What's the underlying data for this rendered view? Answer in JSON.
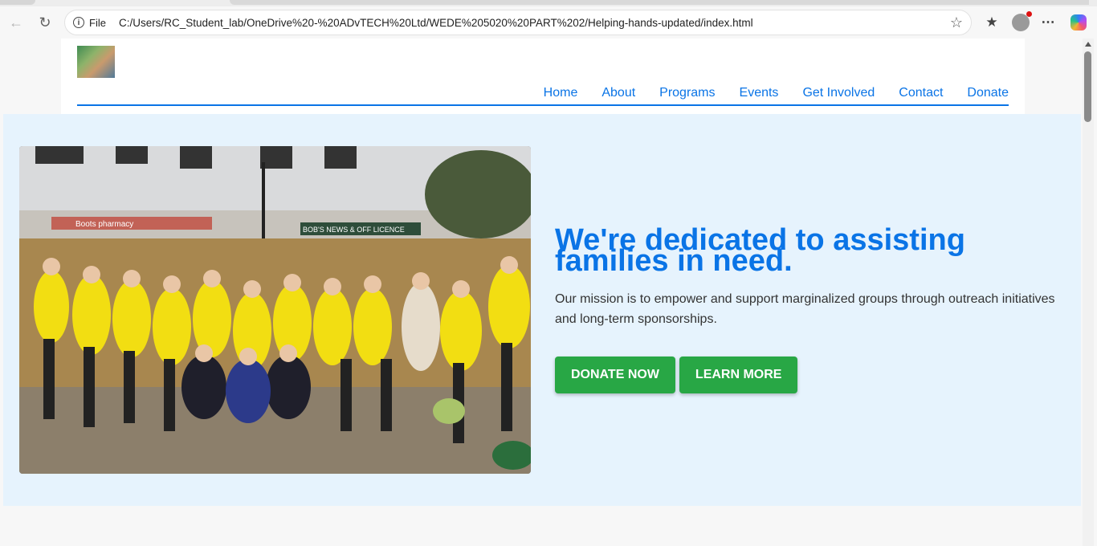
{
  "browser": {
    "scheme_label": "File",
    "url": "C:/Users/RC_Student_lab/OneDrive%20-%20ADvTECH%20Ltd/WEDE%205020%20PART%202/Helping-hands-updated/index.html",
    "icons": [
      "back-icon",
      "reload-icon",
      "info-icon",
      "star-icon",
      "favorites-icon",
      "profile-icon",
      "more-icon",
      "copilot-icon"
    ]
  },
  "nav": {
    "items": [
      "Home",
      "About",
      "Programs",
      "Events",
      "Get Involved",
      "Contact",
      "Donate"
    ]
  },
  "hero": {
    "heading": "We're dedicated to assisting families in need.",
    "mission": "Our mission is to empower and support marginalized groups through outreach initiatives and long-term sponsorships.",
    "primary_cta": "DONATE NOW",
    "secondary_cta": "LEARN MORE",
    "photo_sign_left": "Boots pharmacy",
    "photo_sign_right": "BOB'S NEWS & OFF LICENCE"
  },
  "colors": {
    "accent": "#0a74e6",
    "cta": "#28a745",
    "hero_bg": "#e6f3fd"
  }
}
